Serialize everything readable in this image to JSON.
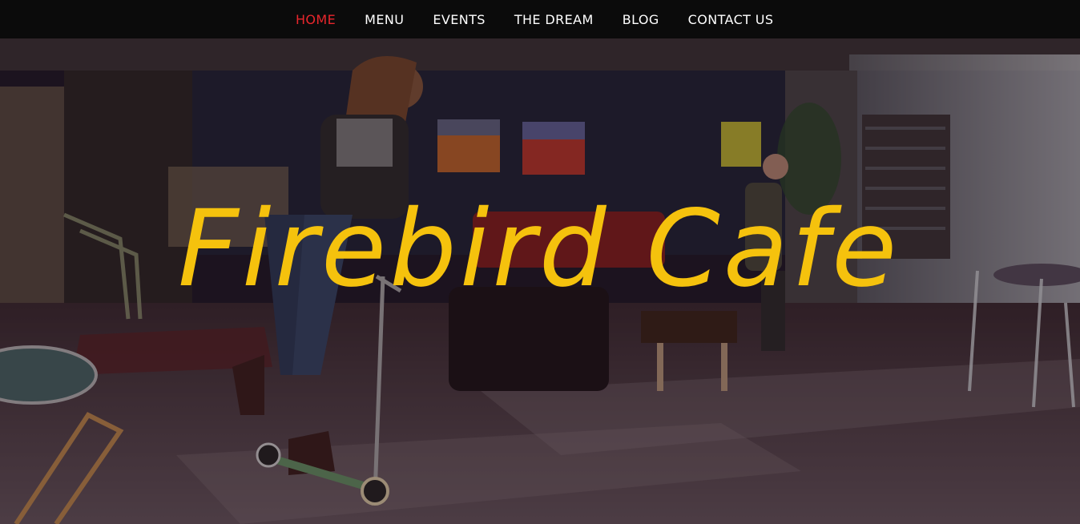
{
  "nav": {
    "items": [
      {
        "label": "HOME",
        "active": true
      },
      {
        "label": "MENU",
        "active": false
      },
      {
        "label": "EVENTS",
        "active": false
      },
      {
        "label": "THE DREAM",
        "active": false
      },
      {
        "label": "BLOG",
        "active": false
      },
      {
        "label": "CONTACT US",
        "active": false
      }
    ],
    "active_color": "#e8262c",
    "text_color": "#ffffff",
    "background": "#0b0b0b"
  },
  "hero": {
    "title": "Firebird Cafe",
    "title_color": "#f5c20d",
    "background_image": "cafe-interior-with-person-on-scooter"
  }
}
